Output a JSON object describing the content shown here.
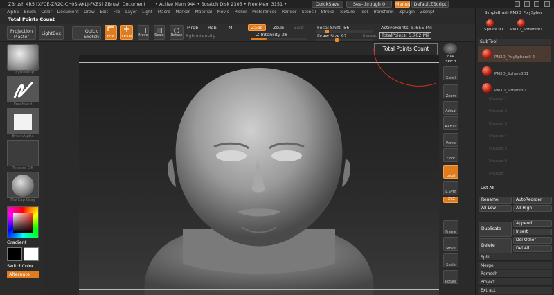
{
  "titlebar": {
    "app_name": "ZBrush 4R5  [XFCE-ZR2C-CH0S-AKLJ-FKBS]    ZBrush Document",
    "stats": "• Active Mem 944  • Scratch Disk 2305  • Free Mem 3151  •",
    "quicksave": "QuickSave",
    "see_through": "See-through  0",
    "menus": "Menus",
    "default_script": "DefaultZScript"
  },
  "menu": [
    "Alpha",
    "Brush",
    "Color",
    "Document",
    "Draw",
    "Edit",
    "File",
    "Layer",
    "Light",
    "Macro",
    "Marker",
    "Material",
    "Movie",
    "Picker",
    "Preferences",
    "Render",
    "Stencil",
    "Stroke",
    "Texture",
    "Tool",
    "Transform",
    "Zplugin",
    "Zscript"
  ],
  "status_label": "Total Points Count",
  "shelf": {
    "projection_master": "Projection Master",
    "lightbox": "LightBox",
    "quick_sketch": "Quick Sketch",
    "edit": "Edit",
    "draw": "Draw",
    "move": "Move",
    "scale": "Scale",
    "rotate": "Rotate",
    "mrgb": "Mrgb",
    "rgb": "Rgb",
    "m": "M",
    "zadd": "Zadd",
    "zsub": "Zsub",
    "zcut": "Zcut",
    "rgb_intensity": "Rgb Intensity",
    "z_intensity": "Z Intensity 28",
    "z_intensity_value": 0.28,
    "focal_shift": "Focal Shift -56",
    "focal_shift_value": -56,
    "draw_size": "Draw Size 97",
    "draw_size_value": 97,
    "dynamic": "Dynamic",
    "active_points": "ActivePoints: 5.655 Mil",
    "total_points": "TotalPoints: 5.702 Mil"
  },
  "left": {
    "clay_buildup": "ClayBuildup",
    "freehand": "FreeHand",
    "brush_alpha": "BrushAlpha",
    "texture_off": "Texture Off",
    "matcap": "MatCap Gray",
    "gradient": "Gradient",
    "switch_color": "SwitchColor",
    "alternate": "Alternate",
    "swatch_color": "#ff3b30"
  },
  "tooltip": "Total Points Count",
  "right": {
    "bpr": "BPR",
    "spix": "SPix 3",
    "scroll": "Scroll",
    "zoom": "Zoom",
    "actual": "Actual",
    "aahalf": "AAHalf",
    "persp": "Persp",
    "floor": "Floor",
    "local": "Local",
    "lsym": "L.Sym",
    "xyz": "·XYZ",
    "frame": "Frame",
    "move": "Move",
    "scale": "Scale",
    "rotate": "Rotate"
  },
  "tray": {
    "simple_brush": "SimpleBrush",
    "pm3d_polysphere": "PM3D_PolySpher",
    "sphere3d": "Sphere3D",
    "pm3d_sphere3d": "PM3D_Sphere3D",
    "subtool_title": "SubTool",
    "subtools": [
      "PM3D_PolySphere0 2",
      "PM3D_Sphere3D1",
      "PM3D_Sphere3D"
    ],
    "empty_slots": [
      "Unused 1",
      "Unused 2",
      "Unused 3",
      "Unused 4",
      "Unused 5",
      "Unused 6",
      "Unused 7"
    ],
    "list_all": "List  All",
    "rename": "Rename",
    "auto_reorder": "AutoReorder",
    "all_low": "All Low",
    "all_high": "All High",
    "duplicate": "Duplicate",
    "append": "Append",
    "insert": "Insert",
    "delete": "Delete",
    "del_other": "Del Other",
    "del_all": "Del All",
    "split": "Split",
    "merge": "Merge",
    "remesh": "Remesh",
    "project": "Project",
    "extract": "Extract"
  },
  "colors": {
    "accent": "#e07b1e",
    "panel": "#2a2a2a"
  }
}
